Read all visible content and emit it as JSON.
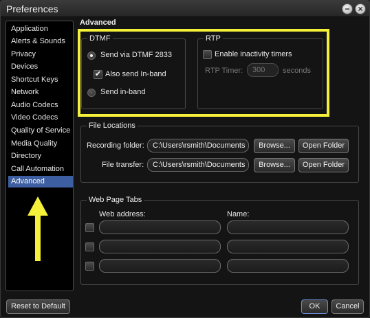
{
  "window": {
    "title": "Preferences"
  },
  "sidebar": {
    "items": [
      {
        "label": "Application"
      },
      {
        "label": "Alerts & Sounds"
      },
      {
        "label": "Privacy"
      },
      {
        "label": "Devices"
      },
      {
        "label": "Shortcut Keys"
      },
      {
        "label": "Network"
      },
      {
        "label": "Audio Codecs"
      },
      {
        "label": "Video Codecs"
      },
      {
        "label": "Quality of Service"
      },
      {
        "label": "Media Quality"
      },
      {
        "label": "Directory"
      },
      {
        "label": "Call Automation"
      },
      {
        "label": "Advanced",
        "selected": true
      }
    ]
  },
  "section_title": "Advanced",
  "dtmf": {
    "group_label": "DTMF",
    "send_via_dtmf_2833": "Send via DTMF 2833",
    "also_send_inband": "Also send In-band",
    "send_inband": "Send in-band",
    "selected_option": "Send via DTMF 2833",
    "also_send_inband_checked": true
  },
  "rtp": {
    "group_label": "RTP",
    "enable_inactivity_timers": "Enable inactivity timers",
    "enable_inactivity_timers_checked": false,
    "rtp_timer_label": "RTP Timer:",
    "rtp_timer_value": "300",
    "rtp_timer_unit": "seconds"
  },
  "file_locations": {
    "group_label": "File Locations",
    "recording_folder_label": "Recording folder:",
    "recording_folder_value": "C:\\Users\\rsmith\\Documents",
    "file_transfer_label": "File transfer:",
    "file_transfer_value": "C:\\Users\\rsmith\\Documents",
    "browse_label": "Browse...",
    "open_folder_label": "Open Folder"
  },
  "web_page_tabs": {
    "group_label": "Web Page Tabs",
    "web_address_header": "Web address:",
    "name_header": "Name:",
    "rows": [
      {
        "enabled": false,
        "web_address": "",
        "name": ""
      },
      {
        "enabled": false,
        "web_address": "",
        "name": ""
      },
      {
        "enabled": false,
        "web_address": "",
        "name": ""
      }
    ]
  },
  "footer": {
    "reset_label": "Reset to Default",
    "ok_label": "OK",
    "cancel_label": "Cancel"
  },
  "annotation": {
    "highlight_color": "#f5f03a",
    "arrow_color": "#f5f03a"
  }
}
